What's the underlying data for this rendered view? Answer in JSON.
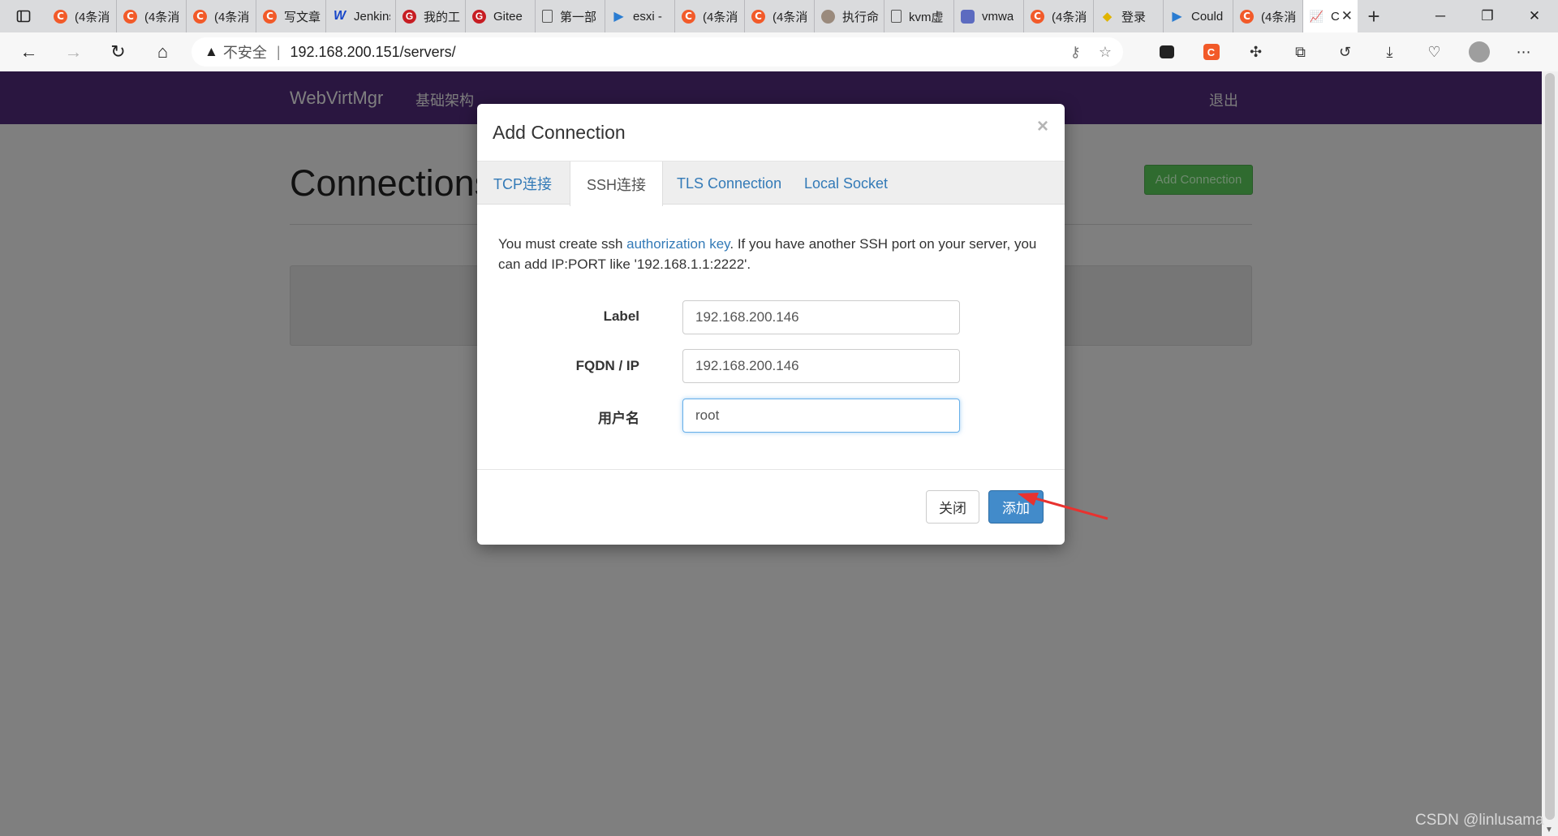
{
  "browser": {
    "tabs": [
      {
        "title": "(4条消",
        "icon": "csdn-icon"
      },
      {
        "title": "(4条消",
        "icon": "csdn-icon"
      },
      {
        "title": "(4条消",
        "icon": "csdn-icon"
      },
      {
        "title": "写文章",
        "icon": "csdn-icon"
      },
      {
        "title": "Jenkins",
        "icon": "w-icon"
      },
      {
        "title": "我的工",
        "icon": "gitee-icon"
      },
      {
        "title": "Gitee",
        "icon": "gitee-icon"
      },
      {
        "title": "第一部",
        "icon": "document-icon"
      },
      {
        "title": "esxi -",
        "icon": "bing-icon"
      },
      {
        "title": "(4条消",
        "icon": "csdn-icon"
      },
      {
        "title": "(4条消",
        "icon": "csdn-icon"
      },
      {
        "title": "执行命",
        "icon": "person-icon"
      },
      {
        "title": "kvm虚",
        "icon": "document-icon"
      },
      {
        "title": "vmwa",
        "icon": "vm-icon"
      },
      {
        "title": "(4条消",
        "icon": "csdn-icon"
      },
      {
        "title": "登录",
        "icon": "key-icon"
      },
      {
        "title": "Could",
        "icon": "bing-icon"
      },
      {
        "title": "(4条消",
        "icon": "csdn-icon"
      }
    ],
    "active_tab": {
      "title": "C",
      "icon": "chart-icon"
    },
    "address": {
      "insecure_label": "不安全",
      "url": "192.168.200.151/servers/"
    }
  },
  "app": {
    "brand": "WebVirtMgr",
    "nav_link": "基础架构",
    "logout": "退出",
    "page_title": "Connections",
    "add_button": "Add Connection"
  },
  "modal": {
    "title": "Add Connection",
    "close": "×",
    "tabs": [
      "TCP连接",
      "SSH连接",
      "TLS Connection",
      "Local Socket"
    ],
    "active_tab_index": 1,
    "help_prefix": "You must create ssh ",
    "help_link": "authorization key",
    "help_suffix": ". If you have another SSH port on your server, you can add IP:PORT like '192.168.1.1:2222'.",
    "fields": {
      "label": {
        "label": "Label",
        "value": "192.168.200.146"
      },
      "fqdn": {
        "label": "FQDN / IP",
        "value": "192.168.200.146"
      },
      "username": {
        "label": "用户名",
        "value": "root"
      }
    },
    "close_button": "关闭",
    "submit_button": "添加"
  },
  "watermark": "CSDN @linlusama",
  "colors": {
    "navbar": "#2a1640",
    "primary": "#428bca",
    "success": "#2f6b2f",
    "annotation_arrow": "#e8322f"
  }
}
